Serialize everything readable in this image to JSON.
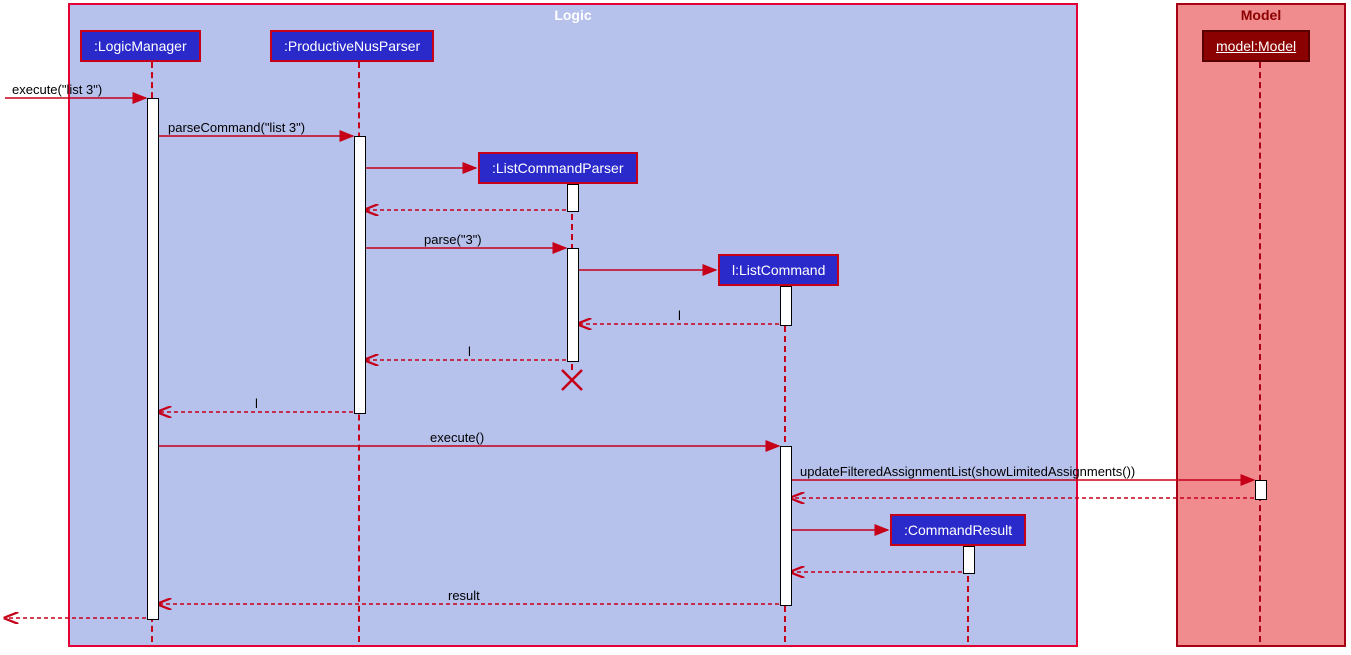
{
  "containers": {
    "logic": {
      "title": "Logic",
      "bg": "#B6C1EC",
      "border": "#E20036",
      "title_bg": "transparent",
      "title_color": "#FFFFFF"
    },
    "model": {
      "title": "Model",
      "bg": "#F08B8E",
      "border": "#A80015",
      "title_bg": "transparent",
      "title_color": "#8B0000"
    }
  },
  "participants": {
    "logicManager": {
      "label": ":LogicManager"
    },
    "productiveNusParser": {
      "label": ":ProductiveNusParser"
    },
    "listCommandParser": {
      "label": ":ListCommandParser"
    },
    "listCommand": {
      "label": "l:ListCommand"
    },
    "commandResult": {
      "label": ":CommandResult"
    },
    "modelModel": {
      "label": "model:Model"
    }
  },
  "messages": {
    "m1": {
      "label": "execute(\"list 3\")"
    },
    "m2": {
      "label": "parseCommand(\"list 3\")"
    },
    "m3": {
      "label": "parse(\"3\")"
    },
    "m4": {
      "label": "l"
    },
    "m5": {
      "label": "l"
    },
    "m6": {
      "label": "l"
    },
    "m7": {
      "label": "execute()"
    },
    "m8": {
      "label": "updateFilteredAssignmentList(showLimitedAssignments())"
    },
    "m9": {
      "label": "result"
    }
  },
  "colors": {
    "logic_participant_bg": "#2A2ACB",
    "logic_participant_border": "#C7001A",
    "logic_participant_text": "#FFFFFF",
    "model_participant_bg": "#8B0000",
    "model_participant_border": "#5A0000",
    "model_participant_text": "#FFFFFF",
    "arrow": "#C7001A"
  }
}
